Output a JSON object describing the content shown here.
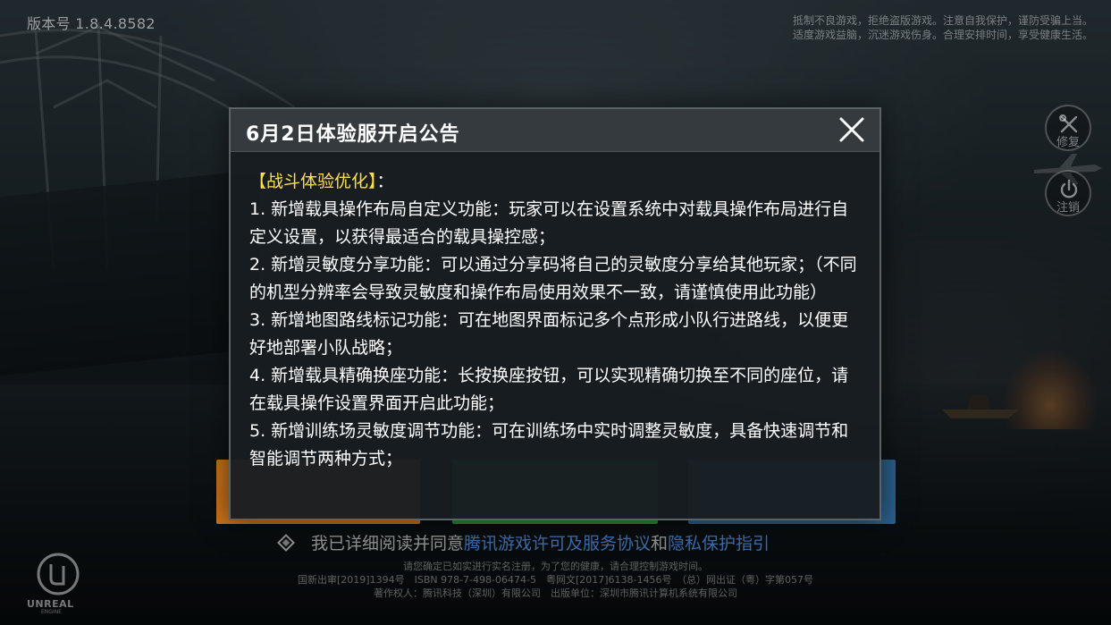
{
  "app": {
    "version": "版本号 1.8.4.8582",
    "health_notice_line1": "抵制不良游戏，拒绝盗版游戏。注意自我保护，谨防受骗上当。",
    "health_notice_line2": "适度游戏益脑，沉迷游戏伤身。合理安排时间，享受健康生活。"
  },
  "side_buttons": {
    "repair_label": "修复",
    "logout_label": "注销"
  },
  "modal": {
    "title": "6月2日体验服开启公告",
    "section_title": "【战斗体验优化】",
    "section_colon": "：",
    "items": [
      "1. 新增载具操作布局自定义功能：玩家可以在设置系统中对载具操作布局进行自定义设置，以获得最适合的载具操控感；",
      "2. 新增灵敏度分享功能：可以通过分享码将自己的灵敏度分享给其他玩家；（不同的机型分辨率会导致灵敏度和操作布局使用效果不一致，请谨慎使用此功能）",
      "3. 新增地图路线标记功能：可在地图界面标记多个点形成小队行进路线，以便更好地部署小队战略；",
      "4. 新增载具精确换座功能：长按换座按钮，可以实现精确切换至不同的座位，请在载具操作设置界面开启此功能；",
      "5. 新增训练场灵敏度调节功能：可在训练场中实时调整灵敏度，具备快速调节和智能调节两种方式；"
    ]
  },
  "agreement": {
    "prefix": "我已详细阅读并同意",
    "link1": "腾讯游戏许可及服务协议",
    "joiner": "和",
    "link2": "隐私保护指引"
  },
  "footer": {
    "line1": "请您确定已如实进行实名注册，为了您的健康，请合理控制游戏时间。",
    "line2": "国新出审[2019]1394号　ISBN 978-7-498-06474-5　粤网文[2017]6138-1456号　（总）网出证（粤）字第057号",
    "line3": "著作权人：腾讯科技（深圳）有限公司　出版单位：深圳市腾讯计算机系统有限公司"
  },
  "engine_logo": {
    "name": "UNREAL",
    "sub": "ENGINE"
  },
  "colors": {
    "section_title": "#ffe04a",
    "modal_bg": "#181d21",
    "modal_header": "#343a3d",
    "link": "#5aa0ff"
  }
}
